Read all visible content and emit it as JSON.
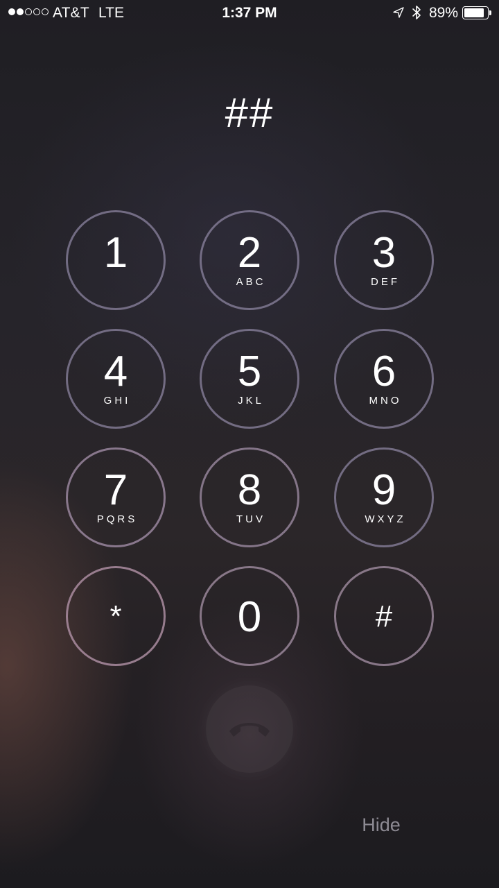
{
  "status_bar": {
    "signal_bars_filled": 2,
    "signal_bars_total": 5,
    "carrier": "AT&T",
    "network": "LTE",
    "time": "1:37 PM",
    "icons": [
      "location-arrow-icon",
      "bluetooth-icon",
      "battery-icon"
    ],
    "battery_percent": "89%",
    "battery_level": 0.89
  },
  "dialed_number": "##",
  "keypad": {
    "keys": [
      {
        "digit": "1",
        "letters": ""
      },
      {
        "digit": "2",
        "letters": "ABC"
      },
      {
        "digit": "3",
        "letters": "DEF"
      },
      {
        "digit": "4",
        "letters": "GHI"
      },
      {
        "digit": "5",
        "letters": "JKL"
      },
      {
        "digit": "6",
        "letters": "MNO"
      },
      {
        "digit": "7",
        "letters": "PQRS"
      },
      {
        "digit": "8",
        "letters": "TUV"
      },
      {
        "digit": "9",
        "letters": "WXYZ"
      },
      {
        "digit": "*",
        "letters": ""
      },
      {
        "digit": "0",
        "letters": ""
      },
      {
        "digit": "#",
        "letters": ""
      }
    ]
  },
  "call_button": {
    "icon": "end-call-handset-icon"
  },
  "hide_label": "Hide",
  "colors": {
    "text": "#ffffff",
    "key_border": "#8c84a0",
    "hide_text": "#8d8a93"
  }
}
